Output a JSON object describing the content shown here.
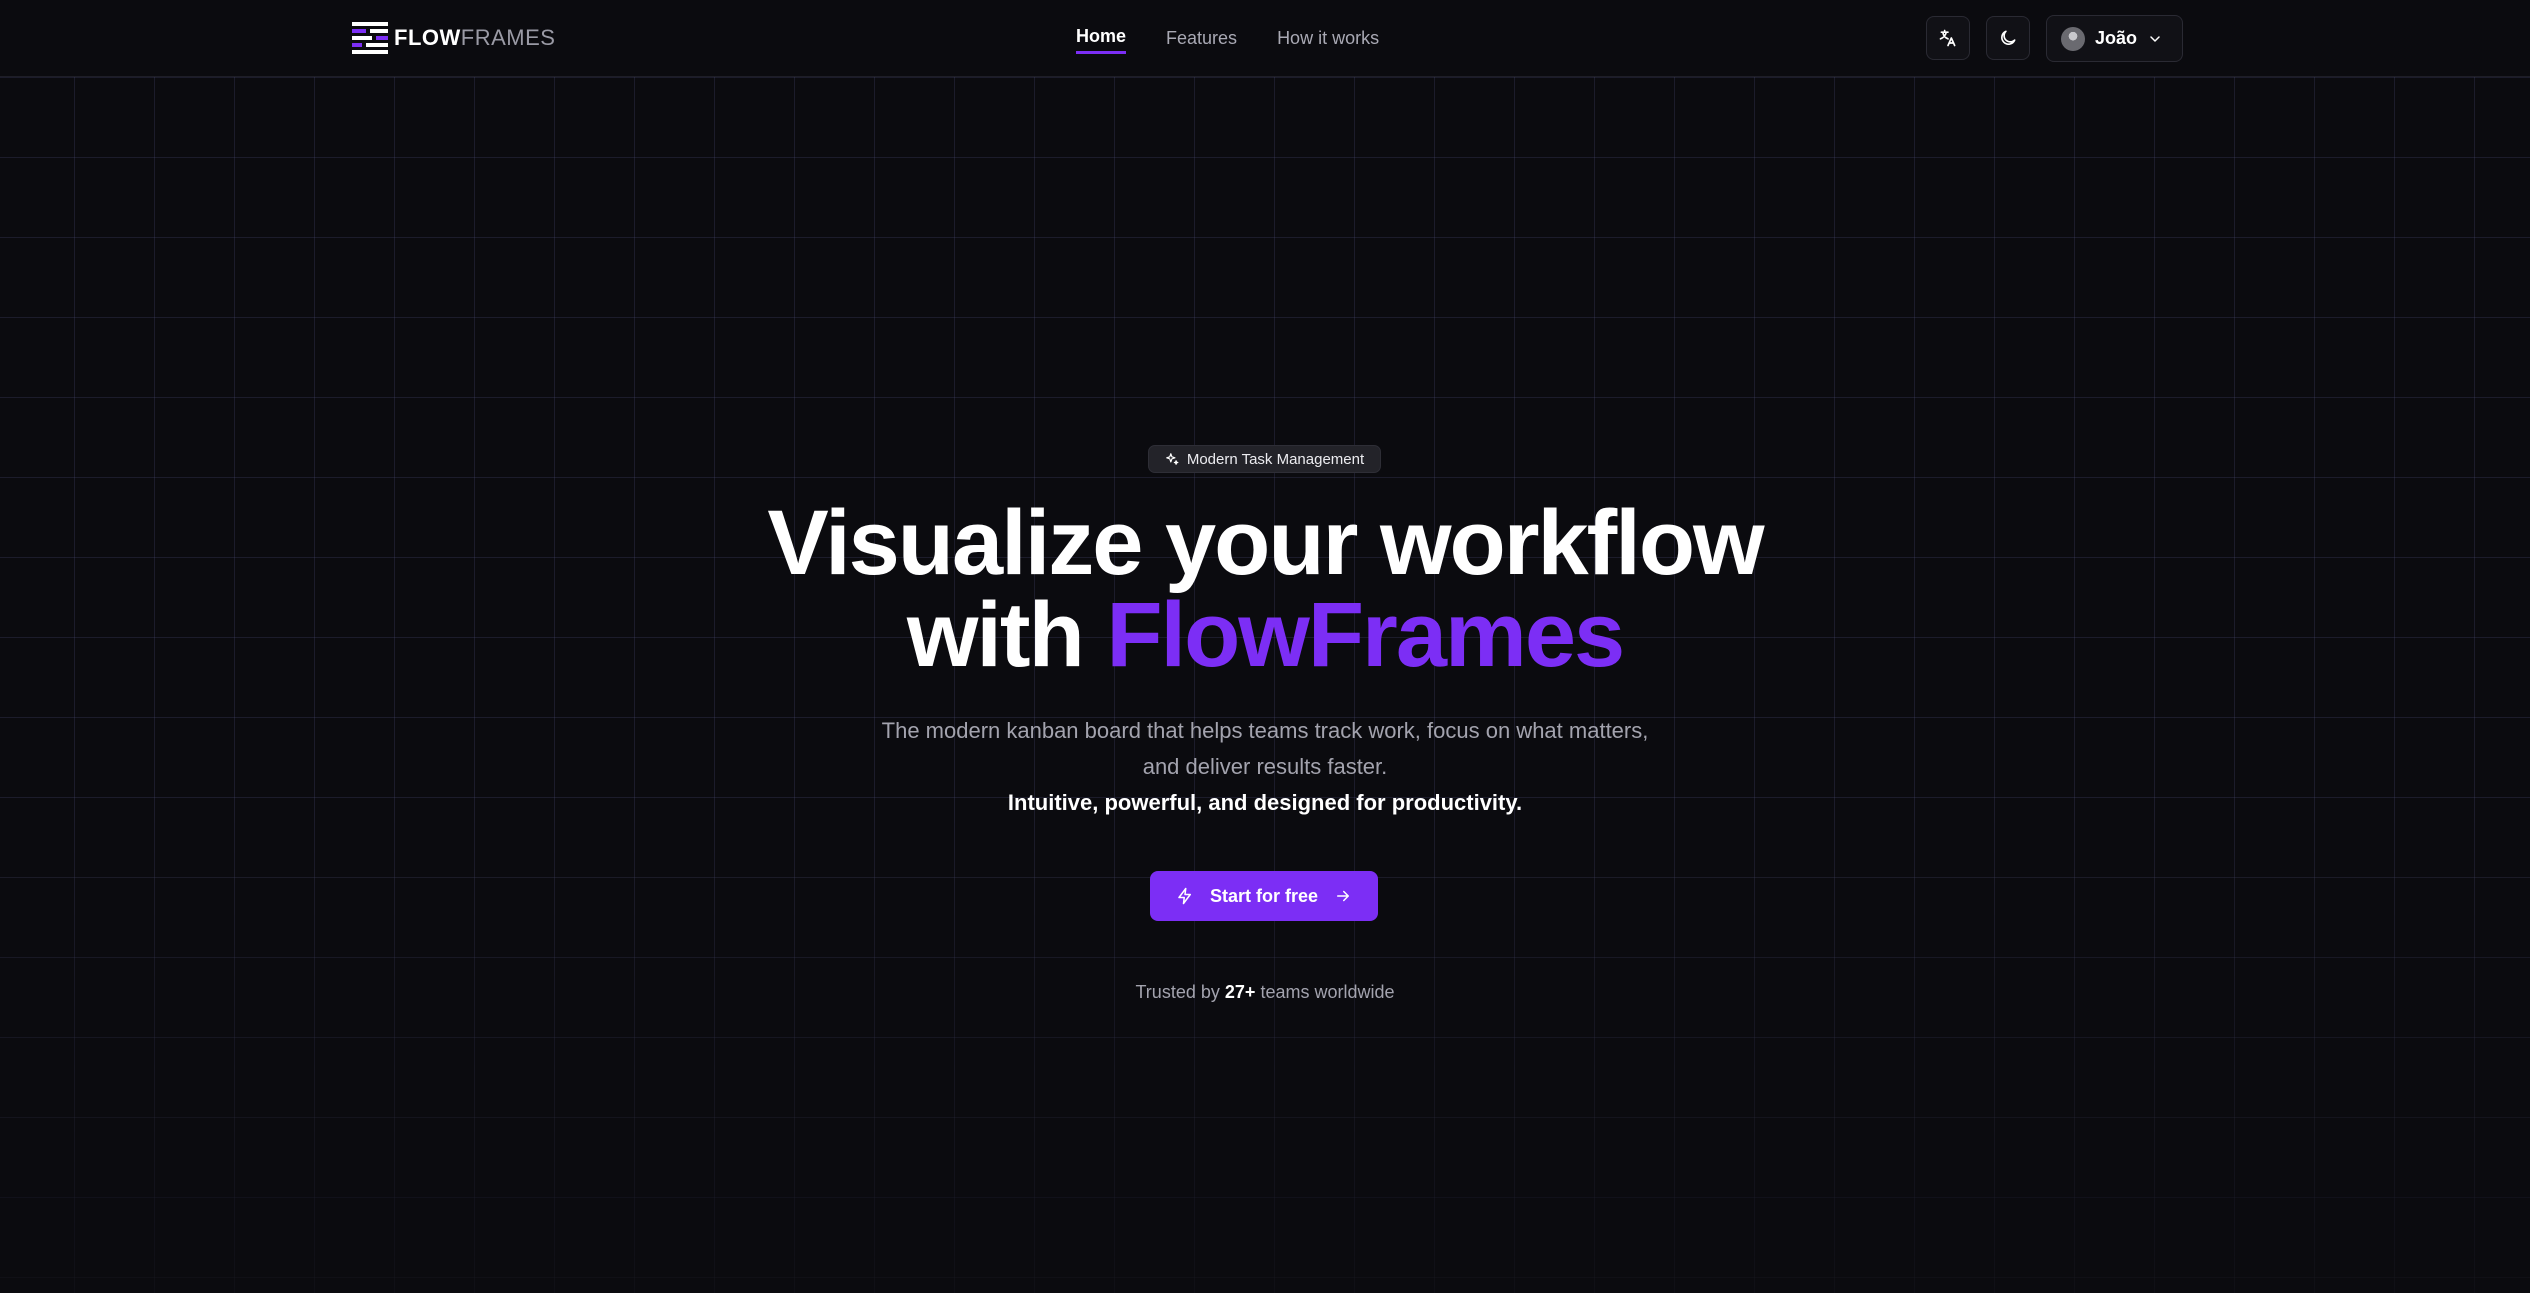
{
  "header": {
    "logo": {
      "bold": "FLOW",
      "light": "FRAMES"
    },
    "nav": [
      {
        "label": "Home",
        "active": true
      },
      {
        "label": "Features",
        "active": false
      },
      {
        "label": "How it works",
        "active": false
      }
    ],
    "icons": {
      "language": "translate-icon",
      "theme": "moon-icon",
      "dropdown": "chevron-down-icon"
    },
    "user": {
      "name": "João"
    }
  },
  "hero": {
    "badge": "Modern Task Management",
    "title_line1": "Visualize your workflow",
    "title_prefix": "with",
    "title_accent": "FlowFrames",
    "subtitle_line1": "The modern kanban board that helps teams track work, focus on what matters,",
    "subtitle_line2": "and deliver results faster.",
    "subtitle_bold": "Intuitive, powerful, and designed for productivity.",
    "cta_label": "Start for free",
    "trust_prefix": "Trusted by",
    "trust_count": "27+",
    "trust_suffix": "teams worldwide"
  },
  "colors": {
    "background": "#0b0b0f",
    "accent": "#7c2ef5",
    "muted_text": "#a3a3ae"
  }
}
